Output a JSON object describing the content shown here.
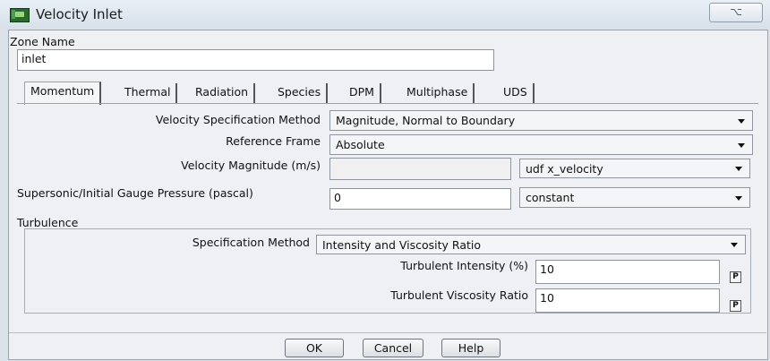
{
  "window": {
    "title": "Velocity Inlet",
    "close_label": "⌥",
    "icon": "fluent-app-icon"
  },
  "zone": {
    "label": "Zone Name",
    "value": "inlet"
  },
  "tabs": [
    {
      "label": "Momentum",
      "active": true
    },
    {
      "label": "Thermal",
      "active": false
    },
    {
      "label": "Radiation",
      "active": false
    },
    {
      "label": "Species",
      "active": false
    },
    {
      "label": "DPM",
      "active": false
    },
    {
      "label": "Multiphase",
      "active": false
    },
    {
      "label": "UDS",
      "active": false
    }
  ],
  "momentum": {
    "velocity_spec_method": {
      "label": "Velocity Specification Method",
      "value": "Magnitude, Normal to Boundary"
    },
    "reference_frame": {
      "label": "Reference Frame",
      "value": "Absolute"
    },
    "velocity_magnitude": {
      "label": "Velocity Magnitude (m/s)",
      "value": "",
      "profile": "udf x_velocity"
    },
    "gauge_pressure": {
      "label": "Supersonic/Initial Gauge Pressure (pascal)",
      "value": "0",
      "profile": "constant"
    }
  },
  "turbulence": {
    "group_label": "Turbulence",
    "spec_method": {
      "label": "Specification Method",
      "value": "Intensity and Viscosity Ratio"
    },
    "intensity": {
      "label": "Turbulent Intensity (%)",
      "value": "10",
      "param_button": "P"
    },
    "viscosity_ratio": {
      "label": "Turbulent Viscosity Ratio",
      "value": "10",
      "param_button": "P"
    }
  },
  "buttons": {
    "ok": "OK",
    "cancel": "Cancel",
    "help": "Help"
  }
}
